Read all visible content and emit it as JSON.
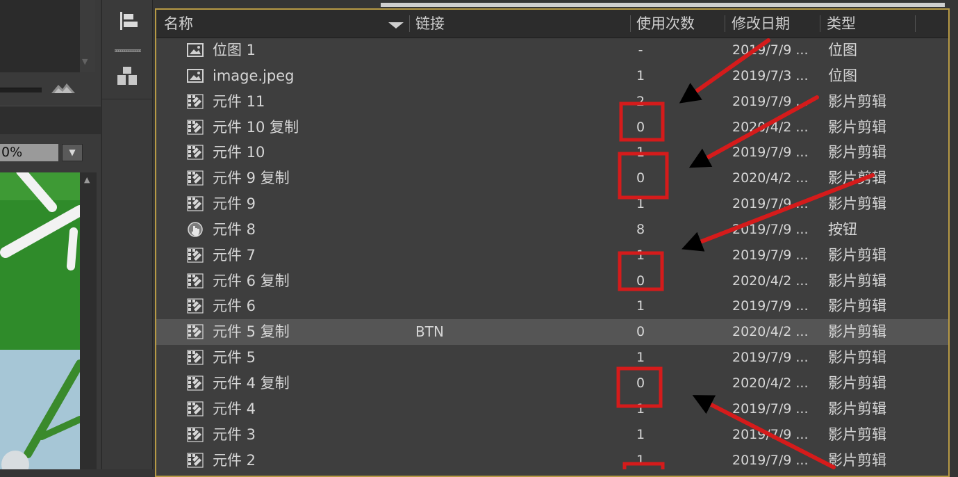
{
  "stage": {
    "zoom_value": "0%",
    "colors": {
      "grass": "#3e9a35",
      "field": "#2f8b2a",
      "sky": "#a6c6d6",
      "road": "#f2f2f2"
    }
  },
  "toolbar": {
    "icons": [
      "align-left-icon",
      "grip-icon",
      "distribute-icon"
    ]
  },
  "library": {
    "columns": {
      "name": "名称",
      "linkage": "链接",
      "use_count": "使用次数",
      "date_modified": "修改日期",
      "type": "类型"
    },
    "sort_indicator_icon": "sort-down-triangle-icon",
    "selected_row": 11,
    "items": [
      {
        "icon": "bitmap-icon",
        "name": "位图 1",
        "linkage": "",
        "uses": "-",
        "date": "2019/7/9 ...",
        "type": "位图"
      },
      {
        "icon": "bitmap-icon",
        "name": "image.jpeg",
        "linkage": "",
        "uses": "1",
        "date": "2019/7/3 ...",
        "type": "位图"
      },
      {
        "icon": "movieclip-icon",
        "name": "元件 11",
        "linkage": "",
        "uses": "2",
        "date": "2019/7/9 ...",
        "type": "影片剪辑"
      },
      {
        "icon": "movieclip-icon",
        "name": "元件 10 复制",
        "linkage": "",
        "uses": "0",
        "date": "2020/4/2 ...",
        "type": "影片剪辑"
      },
      {
        "icon": "movieclip-icon",
        "name": "元件 10",
        "linkage": "",
        "uses": "1",
        "date": "2019/7/9 ...",
        "type": "影片剪辑"
      },
      {
        "icon": "movieclip-icon",
        "name": "元件 9 复制",
        "linkage": "",
        "uses": "0",
        "date": "2020/4/2 ...",
        "type": "影片剪辑"
      },
      {
        "icon": "movieclip-icon",
        "name": "元件 9",
        "linkage": "",
        "uses": "1",
        "date": "2019/7/9 ...",
        "type": "影片剪辑"
      },
      {
        "icon": "button-icon",
        "name": "元件 8",
        "linkage": "",
        "uses": "8",
        "date": "2019/7/9 ...",
        "type": "按钮"
      },
      {
        "icon": "movieclip-icon",
        "name": "元件 7",
        "linkage": "",
        "uses": "1",
        "date": "2019/7/9 ...",
        "type": "影片剪辑"
      },
      {
        "icon": "movieclip-icon",
        "name": "元件 6 复制",
        "linkage": "",
        "uses": "0",
        "date": "2020/4/2 ...",
        "type": "影片剪辑"
      },
      {
        "icon": "movieclip-icon",
        "name": "元件 6",
        "linkage": "",
        "uses": "1",
        "date": "2019/7/9 ...",
        "type": "影片剪辑"
      },
      {
        "icon": "movieclip-icon",
        "name": "元件 5 复制",
        "linkage": "BTN",
        "uses": "0",
        "date": "2020/4/2 ...",
        "type": "影片剪辑"
      },
      {
        "icon": "movieclip-icon",
        "name": "元件 5",
        "linkage": "",
        "uses": "1",
        "date": "2019/7/9 ...",
        "type": "影片剪辑"
      },
      {
        "icon": "movieclip-icon",
        "name": "元件 4 复制",
        "linkage": "",
        "uses": "0",
        "date": "2020/4/2 ...",
        "type": "影片剪辑"
      },
      {
        "icon": "movieclip-icon",
        "name": "元件 4",
        "linkage": "",
        "uses": "1",
        "date": "2019/7/9 ...",
        "type": "影片剪辑"
      },
      {
        "icon": "movieclip-icon",
        "name": "元件 3",
        "linkage": "",
        "uses": "1",
        "date": "2019/7/9 ...",
        "type": "影片剪辑"
      },
      {
        "icon": "movieclip-icon",
        "name": "元件 2",
        "linkage": "",
        "uses": "1",
        "date": "2019/7/9 ...",
        "type": "影片剪辑"
      }
    ]
  },
  "annotations": {
    "color": "#d51b1b",
    "marker_shapes": [
      "rectangle",
      "arrow"
    ]
  }
}
